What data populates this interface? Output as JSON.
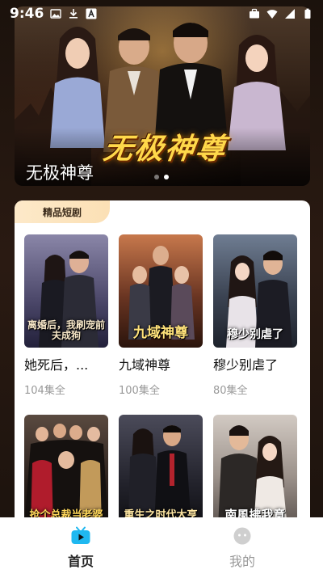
{
  "status_bar": {
    "time": "9:46"
  },
  "banner": {
    "title_art": "无极神尊",
    "caption": "无极神尊",
    "slide_count": 2,
    "active_slide": 2
  },
  "section": {
    "label": "精品短剧"
  },
  "dramas": [
    {
      "poster_text": "离婚后，我刷宠前夫成狗",
      "name": "她死后，...",
      "episodes": "104集全",
      "colors": [
        "#6e6a8f",
        "#2c2a40"
      ]
    },
    {
      "poster_text": "九域神尊",
      "name": "九域神尊",
      "episodes": "100集全",
      "colors": [
        "#b5613a",
        "#3b1e14"
      ]
    },
    {
      "poster_text": "穆少别虐了",
      "name": "穆少别虐了",
      "episodes": "80集全",
      "colors": [
        "#5d6a7d",
        "#232833"
      ]
    },
    {
      "poster_text": "抢个总裁当老婆",
      "name": "",
      "episodes": "",
      "colors": [
        "#4a3b34",
        "#1c1512"
      ]
    },
    {
      "poster_text": "重生之时代大亨",
      "name": "",
      "episodes": "",
      "colors": [
        "#3a3a48",
        "#121217"
      ]
    },
    {
      "poster_text": "南風拂我意",
      "name": "",
      "episodes": "",
      "colors": [
        "#c9c1bb",
        "#6e6560"
      ]
    }
  ],
  "bottom_nav": {
    "home_label": "首页",
    "mine_label": "我的"
  },
  "icons": {
    "home": "tv-icon",
    "mine": "smile-icon"
  },
  "colors": {
    "accent": "#1fb8f0",
    "tab_bg": "#fbe4bf"
  }
}
